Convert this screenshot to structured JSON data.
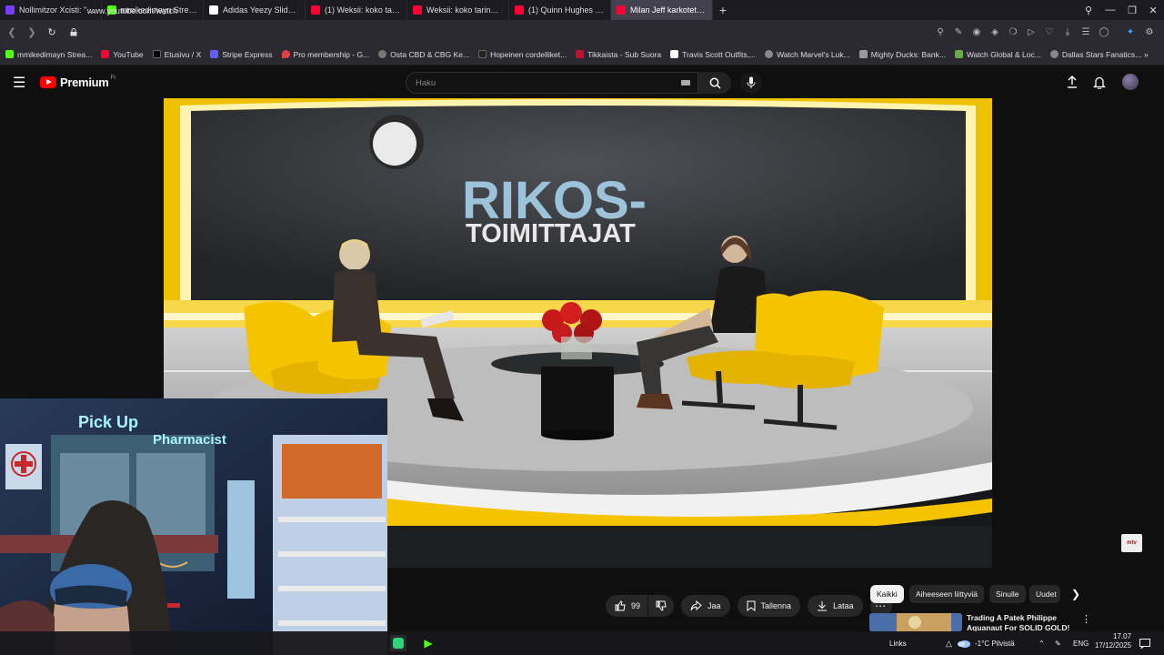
{
  "browser": {
    "tabs": [
      {
        "title": "Nollimitzor Xcisti: \"Kick Stre",
        "icon_color": "#7a3cff",
        "icon": "x-icon"
      },
      {
        "title": "mmikedimayn Stream - Wa",
        "icon_color": "#53fc18",
        "icon": "kick-icon"
      },
      {
        "title": "Adidas Yeezy Slide Azure",
        "icon_color": "#ffffff",
        "icon": "adidas-icon"
      },
      {
        "title": "(1) Weksii: koko tarina sen",
        "icon_color": "#ff0033",
        "icon": "youtube-icon"
      },
      {
        "title": "Weksii: koko tarina sensuro",
        "icon_color": "#ff0033",
        "icon": "youtube-icon"
      },
      {
        "title": "(1) Quinn Hughes Minneso",
        "icon_color": "#ff0033",
        "icon": "youtube-icon"
      },
      {
        "title": "Milan Jeff karkotettiin",
        "icon_color": "#ff0033",
        "icon": "youtube-icon",
        "active": true
      }
    ],
    "url": "www.youtube.com/watch",
    "bookmarks": [
      {
        "label": "mmikedimayn Strea...",
        "color": "#53fc18"
      },
      {
        "label": "YouTube",
        "color": "#ff0033"
      },
      {
        "label": "Etusivu / X",
        "color": "#000000"
      },
      {
        "label": "Stripe Express",
        "color": "#635bff"
      },
      {
        "label": "Pro membership - G...",
        "color": "#e04040"
      },
      {
        "label": "Osta CBD & CBG Ke...",
        "color": "#777777"
      },
      {
        "label": "Hopeinen cordelliket...",
        "color": "#222222"
      },
      {
        "label": "Tikkaista - Sub Suora",
        "color": "#c8102e"
      },
      {
        "label": "Travis Scott Outfits,...",
        "color": "#ffffff"
      },
      {
        "label": "Watch Marvel's Luk...",
        "color": "#888888"
      },
      {
        "label": "Mighty Ducks: Bank...",
        "color": "#999999"
      },
      {
        "label": "Watch Global & Loc...",
        "color": "#6aa84f"
      },
      {
        "label": "Dallas Stars Fanatics...",
        "color": "#888888"
      }
    ]
  },
  "youtube": {
    "logo_text": "Premium",
    "logo_region": "FI",
    "search_placeholder": "Haku",
    "video": {
      "on_screen_title_line1": "RIKOS-",
      "on_screen_title_line2": "TOIMITTAJAT",
      "channel_watermark": "mtv"
    },
    "actions": {
      "like_count": "99",
      "share_label": "Jaa",
      "save_label": "Tallenna",
      "download_label": "Lataa"
    },
    "chips": [
      "Kaikki",
      "Aiheeseen liittyviä",
      "Sinulle",
      "Uudet"
    ],
    "recommendation": {
      "title": "Trading A Patek Philippe Aquanaut For SOLID GOLD!"
    }
  },
  "webcam": {
    "sign_text_left": "Pick Up",
    "sign_text_right": "Pharmacist"
  },
  "taskbar": {
    "links_label": "Links",
    "weather": "-1°C  Pilvistä",
    "language": "ENG",
    "time": "17.07",
    "date": "17/12/2025"
  },
  "colors": {
    "yt_red": "#ff0000",
    "studio_yellow": "#f5c400",
    "bg_dark": "#0f0f0f"
  }
}
